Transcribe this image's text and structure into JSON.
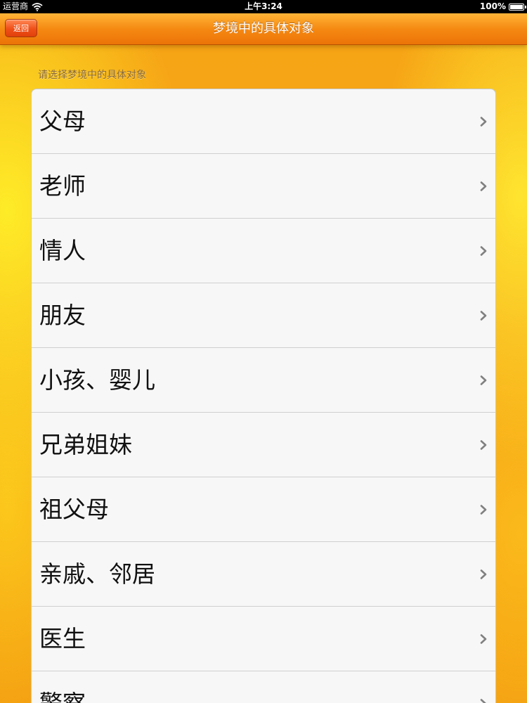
{
  "status_bar": {
    "carrier": "运营商",
    "time": "上午3:24",
    "battery": "100%",
    "icons": [
      "wifi-icon",
      "battery-icon"
    ]
  },
  "nav": {
    "back_label": "返回",
    "title": "梦境中的具体对象"
  },
  "section": {
    "header": "请选择梦境中的具体对象"
  },
  "list": {
    "chevron_icon": "chevron-right-icon",
    "items": [
      {
        "label": "父母"
      },
      {
        "label": "老师"
      },
      {
        "label": "情人"
      },
      {
        "label": "朋友"
      },
      {
        "label": "小孩、婴儿"
      },
      {
        "label": "兄弟姐妹"
      },
      {
        "label": "祖父母"
      },
      {
        "label": "亲戚、邻居"
      },
      {
        "label": "医生"
      },
      {
        "label": "警察"
      }
    ]
  },
  "colors": {
    "nav_orange": "#f58a12",
    "back_button_red": "#ef4f17",
    "background_yellow": "#f7a81a",
    "list_bg": "#f7f7f7"
  }
}
